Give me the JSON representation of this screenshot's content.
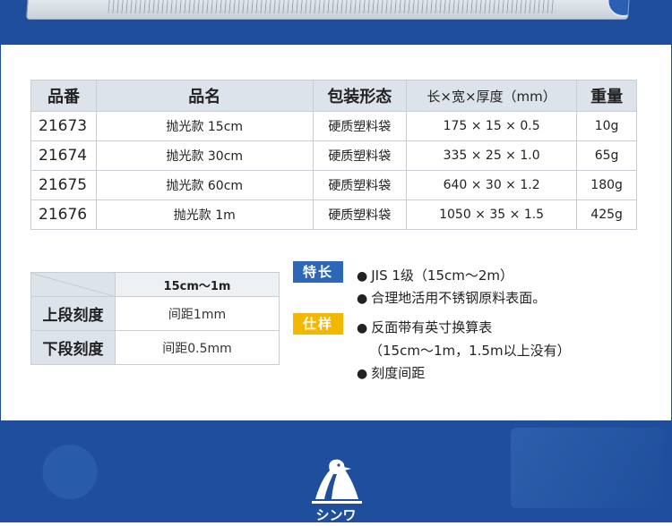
{
  "product_table": {
    "headers": [
      "品番",
      "品名",
      "包装形态",
      "长×宽×厚度（mm）",
      "重量"
    ],
    "rows": [
      {
        "code": "21673",
        "name": "抛光款 15cm",
        "pack": "硬质塑料袋",
        "dims": "175 × 15 × 0.5",
        "weight": "10g"
      },
      {
        "code": "21674",
        "name": "抛光款 30cm",
        "pack": "硬质塑料袋",
        "dims": "335 × 25 × 1.0",
        "weight": "65g"
      },
      {
        "code": "21675",
        "name": "抛光款 60cm",
        "pack": "硬质塑料袋",
        "dims": "640 × 30 × 1.2",
        "weight": "180g"
      },
      {
        "code": "21676",
        "name": "抛光款 1m",
        "pack": "硬质塑料袋",
        "dims": "1050 × 35 × 1.5",
        "weight": "425g"
      }
    ]
  },
  "spec_table": {
    "column_header": "15cm～1m",
    "rows": [
      {
        "label": "上段刻度",
        "value": "间距1mm"
      },
      {
        "label": "下段刻度",
        "value": "间距0.5mm"
      }
    ]
  },
  "features": {
    "tag": "特长",
    "lines": [
      "JIS 1级（15cm～2m）",
      "合理地活用不锈钢原料表面。"
    ]
  },
  "specs": {
    "tag": "仕样",
    "lines": [
      "反面带有英寸换算表",
      "（15cm～1m，1.5m以上没有）",
      "刻度间距"
    ]
  },
  "logo_text": "シンワ",
  "colors": {
    "brand_blue": "#1f4f9c",
    "feature_tag": "#2f67b8",
    "spec_tag": "#f2b700",
    "header_gray": "#dde3ea"
  }
}
